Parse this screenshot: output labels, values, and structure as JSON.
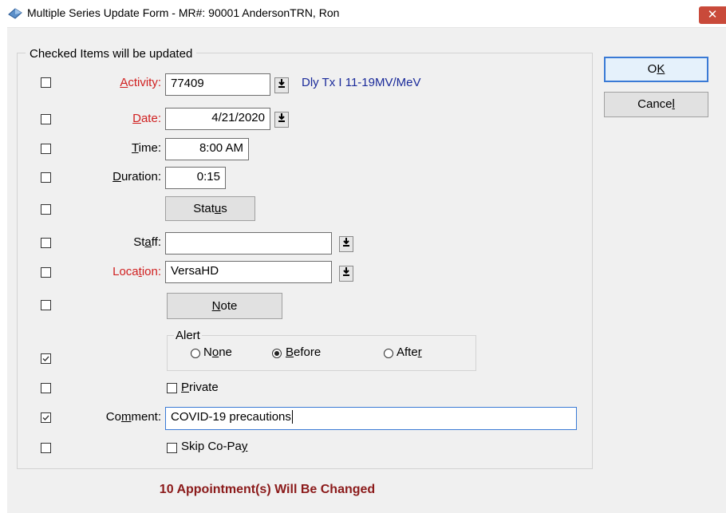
{
  "window": {
    "title": "Multiple Series Update Form - MR#: 90001  AndersonTRN, Ron",
    "close_glyph": "✕"
  },
  "group": {
    "title": "Checked Items will be updated"
  },
  "fields": {
    "activity": {
      "pre": "",
      "key": "A",
      "post": "ctivity:",
      "value": "77409",
      "description": "Dly Tx I 11-19MV/MeV",
      "checked": false
    },
    "date": {
      "pre": "",
      "key": "D",
      "post": "ate:",
      "value": "4/21/2020",
      "checked": false
    },
    "time": {
      "pre": "",
      "key": "T",
      "post": "ime:",
      "value": "8:00 AM",
      "checked": false
    },
    "duration": {
      "pre": "",
      "key": "D",
      "post": "uration:",
      "value": "0:15",
      "checked": false
    },
    "status": {
      "pre": "Stat",
      "key": "u",
      "post": "s",
      "checked": false
    },
    "staff": {
      "pre": "St",
      "key": "a",
      "post": "ff:",
      "value": "",
      "checked": false
    },
    "location": {
      "pre": "Loca",
      "key": "t",
      "post": "ion:",
      "value": "VersaHD",
      "checked": false
    },
    "note": {
      "pre": "",
      "key": "N",
      "post": "ote",
      "checked": false
    },
    "alert": {
      "title": "Alert",
      "checked": true,
      "options": [
        {
          "pre": "N",
          "key": "o",
          "post": "ne",
          "selected": false
        },
        {
          "pre": "",
          "key": "B",
          "post": "efore",
          "selected": true
        },
        {
          "pre": "Afte",
          "key": "r",
          "post": "",
          "selected": false
        }
      ]
    },
    "private": {
      "pre": "",
      "key": "P",
      "post": "rivate",
      "checked": false
    },
    "comment": {
      "pre": "Co",
      "key": "m",
      "post": "ment:",
      "value": "COVID-19 precautions",
      "checked": true
    },
    "skip_copay": {
      "pre": "Skip Co-Pa",
      "key": "y",
      "post": "",
      "checked": false
    }
  },
  "buttons": {
    "ok": {
      "pre": "O",
      "key": "K",
      "post": ""
    },
    "cancel": {
      "pre": "Cance",
      "key": "l",
      "post": ""
    }
  },
  "status_message": "10 Appointment(s) Will Be Changed",
  "colors": {
    "required_label": "#d02020",
    "description_text": "#1a2a9a",
    "status_text": "#8b1a1a",
    "focus_border": "#3a7ad5"
  }
}
